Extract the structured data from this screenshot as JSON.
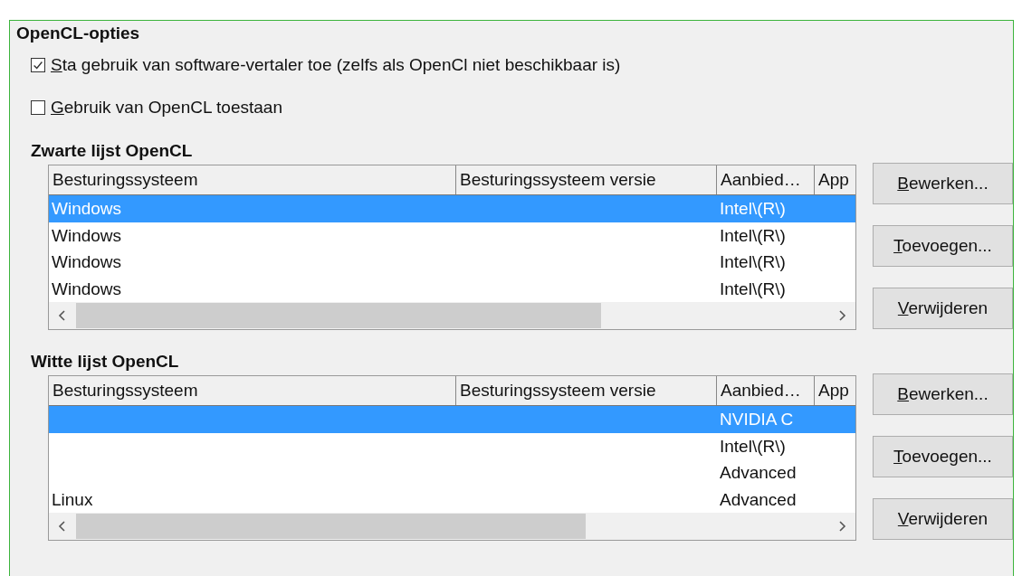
{
  "section": {
    "title": "OpenCL-opties"
  },
  "options": [
    {
      "label": "Sta gebruik van software-vertaler toe (zelfs als OpenCl niet beschikbaar is)",
      "checked": true
    },
    {
      "label": "Gebruik van OpenCL toestaan",
      "checked": false
    }
  ],
  "lists": [
    {
      "title": "Zwarte lijst OpenCL",
      "columns": [
        "Besturingssysteem",
        "Besturingssysteem versie",
        "Aanbied…",
        "App"
      ],
      "rows": [
        {
          "selected": true,
          "os": "Windows",
          "vendor": "Intel\\(R\\)"
        },
        {
          "selected": false,
          "os": "Windows",
          "vendor": "Intel\\(R\\)"
        },
        {
          "selected": false,
          "os": "Windows",
          "vendor": "Intel\\(R\\)"
        },
        {
          "selected": false,
          "os": "Windows",
          "vendor": "Intel\\(R\\)"
        }
      ],
      "buttons": [
        "Bewerken...",
        "Toevoegen...",
        "Verwijderen"
      ]
    },
    {
      "title": "Witte lijst OpenCL",
      "columns": [
        "Besturingssysteem",
        "Besturingssysteem versie",
        "Aanbied…",
        "App"
      ],
      "rows": [
        {
          "selected": true,
          "vendor": "NVIDIA C"
        },
        {
          "selected": false,
          "vendor": "Intel\\(R\\)"
        },
        {
          "selected": false,
          "vendor": "Advanced"
        },
        {
          "selected": false,
          "os": "Linux",
          "vendor": "Advanced"
        }
      ],
      "buttons": [
        "Bewerken...",
        "Toevoegen...",
        "Verwijderen"
      ]
    }
  ]
}
